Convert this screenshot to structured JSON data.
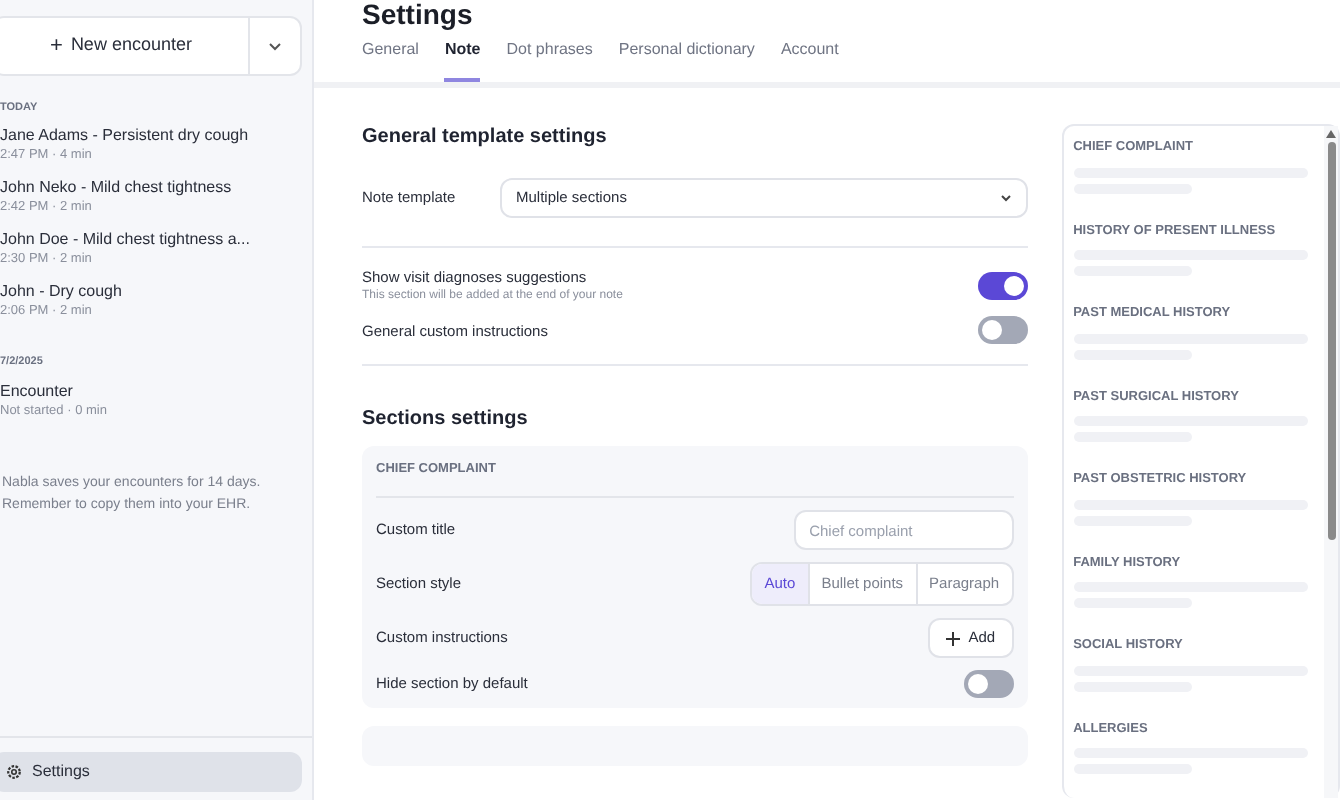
{
  "sidebar": {
    "new_button": {
      "icon": "+",
      "label": "New encounter"
    },
    "groups": [
      {
        "heading": "TODAY",
        "items": [
          {
            "title": "Jane Adams - Persistent dry cough",
            "meta": "2:47 PM · 4 min"
          },
          {
            "title": "John Neko - Mild chest tightness",
            "meta": "2:42 PM · 2 min"
          },
          {
            "title": "John Doe - Mild chest tightness a...",
            "meta": "2:30 PM · 2 min"
          },
          {
            "title": "John - Dry cough",
            "meta": "2:06 PM · 2 min"
          }
        ]
      },
      {
        "heading": "7/2/2025",
        "items": [
          {
            "title": "Encounter",
            "meta": "Not started · 0 min"
          }
        ]
      }
    ],
    "notice": "Nabla saves your encounters for 14 days. Remember to copy them into your EHR.",
    "settings_button": {
      "label": "Settings",
      "selected": true
    }
  },
  "page_title": "Settings",
  "tabs": [
    {
      "label": "General",
      "selected": false
    },
    {
      "label": "Note",
      "selected": true
    },
    {
      "label": "Dot phrases",
      "selected": false
    },
    {
      "label": "Personal dictionary",
      "selected": false
    },
    {
      "label": "Account",
      "selected": false
    }
  ],
  "general": {
    "heading": "General template settings",
    "note_template": {
      "label": "Note template",
      "value": "Multiple sections"
    },
    "toggles": [
      {
        "label": "Show visit diagnoses suggestions",
        "hint": "This section will be added at the end of your note",
        "on": true
      },
      {
        "label": "General custom instructions",
        "on": false
      }
    ]
  },
  "sections": {
    "heading": "Sections settings",
    "card": {
      "title": "CHIEF COMPLAINT",
      "custom_title": {
        "label": "Custom title",
        "placeholder": "Chief complaint"
      },
      "section_style": {
        "label": "Section style",
        "options": [
          {
            "label": "Auto",
            "selected": true
          },
          {
            "label": "Bullet points",
            "selected": false
          },
          {
            "label": "Paragraph",
            "selected": false
          }
        ]
      },
      "custom_instructions": {
        "label": "Custom instructions",
        "button": "Add"
      },
      "hide": {
        "label": "Hide section by default",
        "on": false
      }
    }
  },
  "preview": {
    "sections": [
      "CHIEF COMPLAINT",
      "HISTORY OF PRESENT ILLNESS",
      "PAST MEDICAL HISTORY",
      "PAST SURGICAL HISTORY",
      "PAST OBSTETRIC HISTORY",
      "FAMILY HISTORY",
      "SOCIAL HISTORY",
      "ALLERGIES"
    ]
  }
}
